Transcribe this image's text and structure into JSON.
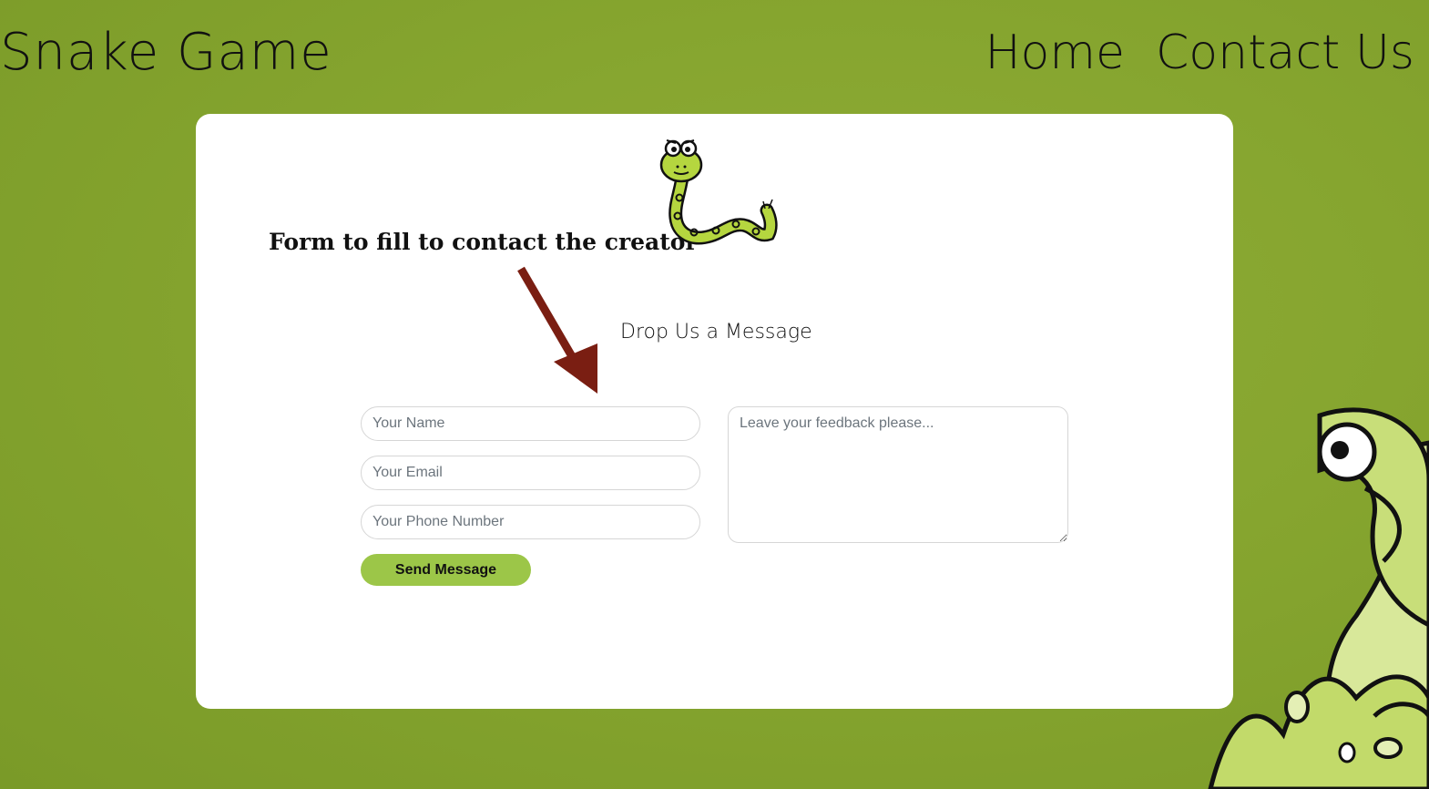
{
  "header": {
    "site_title": "Snake Game",
    "nav": [
      "Home",
      "Contact Us"
    ]
  },
  "contact": {
    "heading": "Form to fill to contact the creator",
    "subheading": "Drop Us a Message",
    "name_placeholder": "Your Name",
    "email_placeholder": "Your Email",
    "phone_placeholder": "Your Phone Number",
    "feedback_placeholder": "Leave your feedback please...",
    "send_label": "Send Message"
  },
  "colors": {
    "background": "#86a52f",
    "button": "#9cc648",
    "arrow": "#7a1e12",
    "snake_body": "#b5d63f"
  },
  "icons": [
    "snake-logo-icon",
    "arrow-down-icon",
    "background-snake-icon"
  ]
}
